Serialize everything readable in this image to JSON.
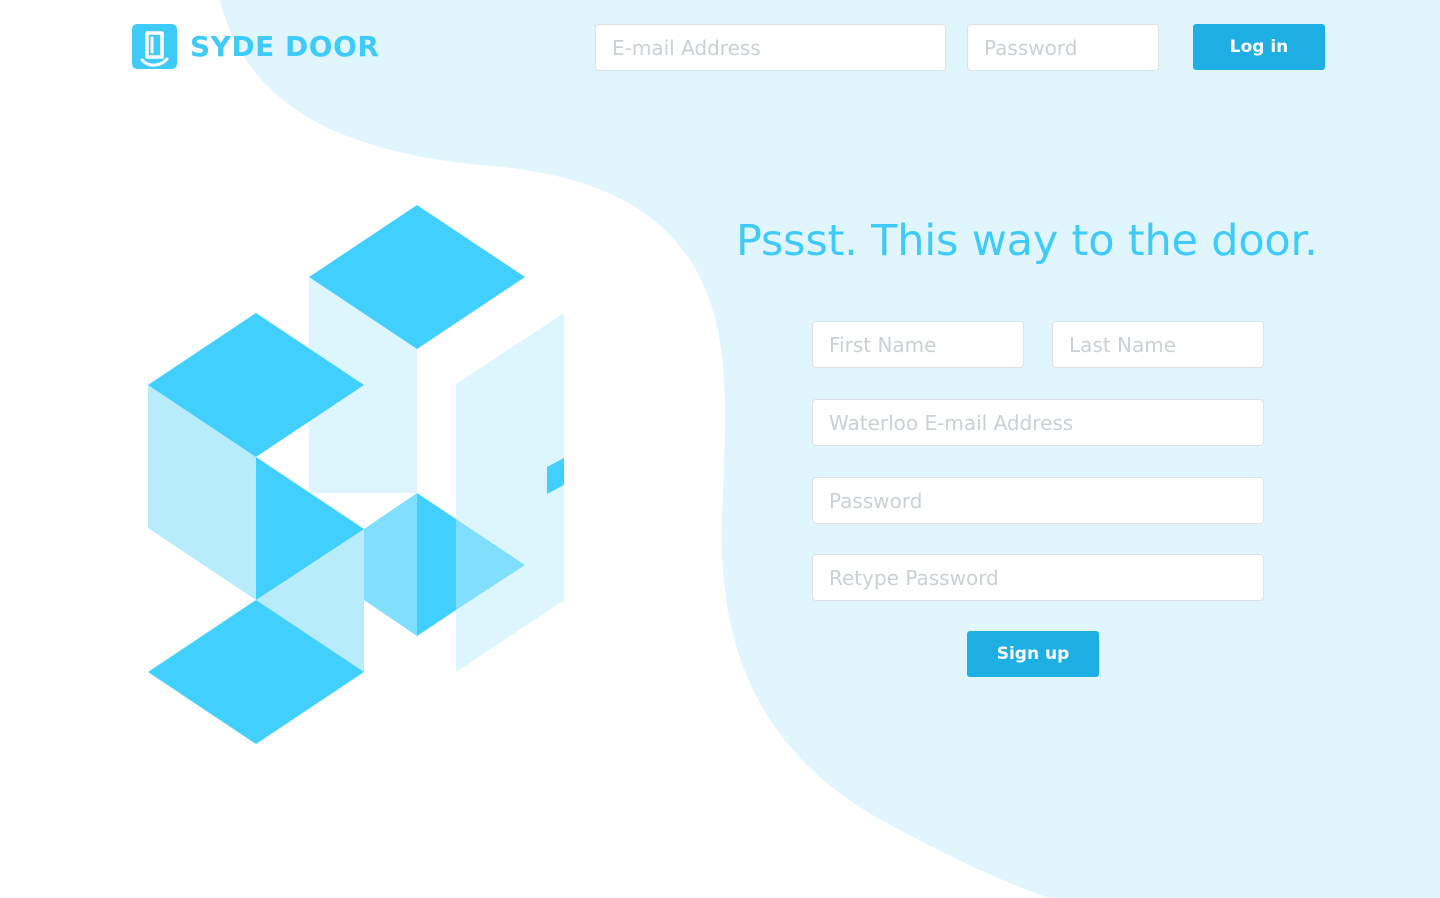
{
  "brand": {
    "name": "SYDE DOOR",
    "color": "#3fcbfa",
    "icon": "door-logo-icon"
  },
  "header": {
    "email_placeholder": "E-mail Address",
    "password_placeholder": "Password",
    "login_label": "Log in"
  },
  "signup": {
    "headline": "Pssst. This way to the door.",
    "first_name_placeholder": "First Name",
    "last_name_placeholder": "Last Name",
    "email_placeholder": "Waterloo E-mail Address",
    "password_placeholder": "Password",
    "retype_password_placeholder": "Retype Password",
    "submit_label": "Sign up"
  },
  "colors": {
    "accent": "#1daee3",
    "brand": "#3fcbfa",
    "background_blob": "#e0f6fc",
    "cube_dark": "#41cffd",
    "cube_mid": "#7fdffc",
    "cube_light": "#b8ecfb"
  }
}
